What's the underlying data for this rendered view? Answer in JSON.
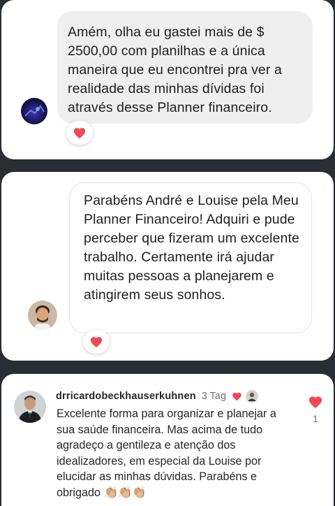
{
  "colors": {
    "heart": "#ed4956",
    "bubble_gray": "#efefef",
    "background": "#2a2e33"
  },
  "comment1": {
    "text": "Amém, olha eu gastei mais de $ 2500,00 com planilhas  e a única maneira que eu encontrei pra ver a realidade das minhas dívidas foi através desse Planner financeiro.",
    "reaction": "heart-icon"
  },
  "comment2": {
    "text": "Parabéns André e Louise pela Meu Planner Financeiro! Adquiri e pude perceber que fizeram um excelente trabalho. Certamente irá ajudar muitas pessoas a planejarem e atingirem seus sonhos.",
    "reaction": "heart-icon"
  },
  "comment3": {
    "username": "drricardobeckhauserkuhnen",
    "time": "3 Tag",
    "text": "Excelente forma para organizar e planejar a sua saúde financeira. Mas acima de tudo agradeço a gentileza e atenção dos idealizadores, em especial da Louise por elucidar as minhas dúvidas. Parabéns e obrigado",
    "emoji": "👏🏼👏🏼👏🏼",
    "like_count": "1"
  }
}
